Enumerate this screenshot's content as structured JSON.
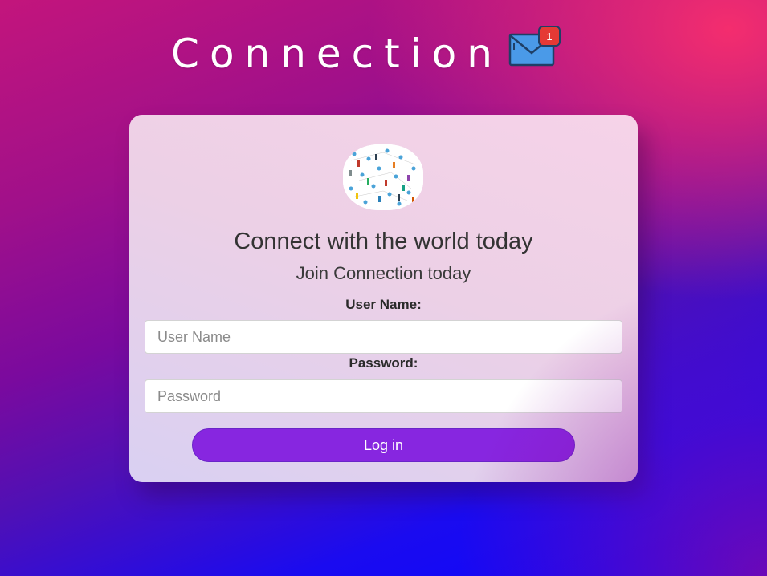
{
  "header": {
    "title": "Connection",
    "notification_count": "1",
    "icon": "mail-icon"
  },
  "card": {
    "avatar_icon": "people-network-icon",
    "headline": "Connect with the world today",
    "subline": "Join Connection today",
    "username_label": "User Name:",
    "username_placeholder": "User Name",
    "username_value": "",
    "password_label": "Password:",
    "password_placeholder": "Password",
    "password_value": "",
    "login_label": "Log in"
  },
  "colors": {
    "accent": "#8726e0",
    "badge": "#e53935",
    "mail": "#4a9ae8"
  }
}
